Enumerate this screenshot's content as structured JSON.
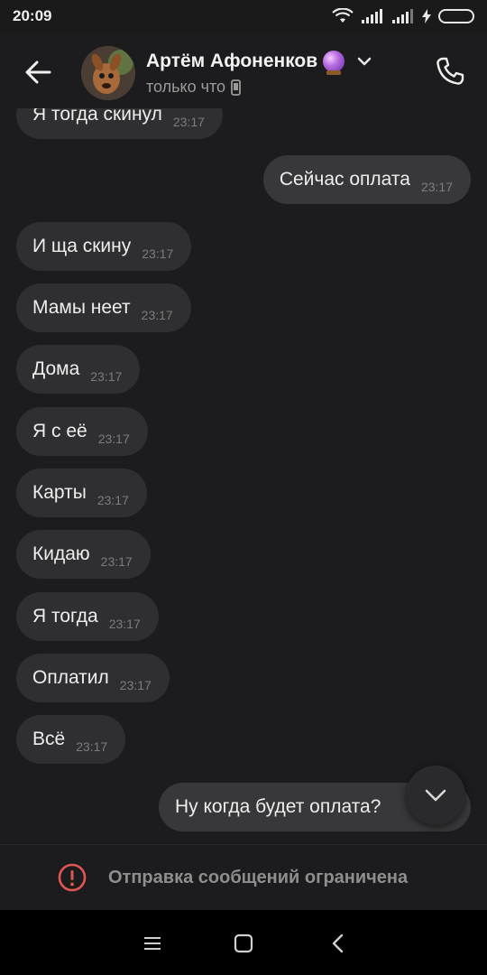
{
  "status_bar": {
    "time": "20:09"
  },
  "header": {
    "contact_name": "Артём Афоненков",
    "contact_status": "только что"
  },
  "messages": [
    {
      "text": "Я тогда скинул",
      "time": "23:17",
      "direction": "in"
    },
    {
      "text": "Сейчас оплата",
      "time": "23:17",
      "direction": "out"
    },
    {
      "text": "И ща скину",
      "time": "23:17",
      "direction": "in"
    },
    {
      "text": "Мамы неет",
      "time": "23:17",
      "direction": "in"
    },
    {
      "text": "Дома",
      "time": "23:17",
      "direction": "in"
    },
    {
      "text": "Я с её",
      "time": "23:17",
      "direction": "in"
    },
    {
      "text": "Карты",
      "time": "23:17",
      "direction": "in"
    },
    {
      "text": "Кидаю",
      "time": "23:17",
      "direction": "in"
    },
    {
      "text": "Я тогда",
      "time": "23:17",
      "direction": "in"
    },
    {
      "text": "Оплатил",
      "time": "23:17",
      "direction": "in"
    },
    {
      "text": "Всё",
      "time": "23:17",
      "direction": "in"
    },
    {
      "text": "Ну когда будет оплата?",
      "time": "",
      "direction": "out"
    }
  ],
  "restricted_banner": {
    "text": "Отправка сообщений ограничена"
  },
  "colors": {
    "background": "#1c1c1e",
    "bubble": "#2f2f31",
    "warning": "#e0574f"
  }
}
